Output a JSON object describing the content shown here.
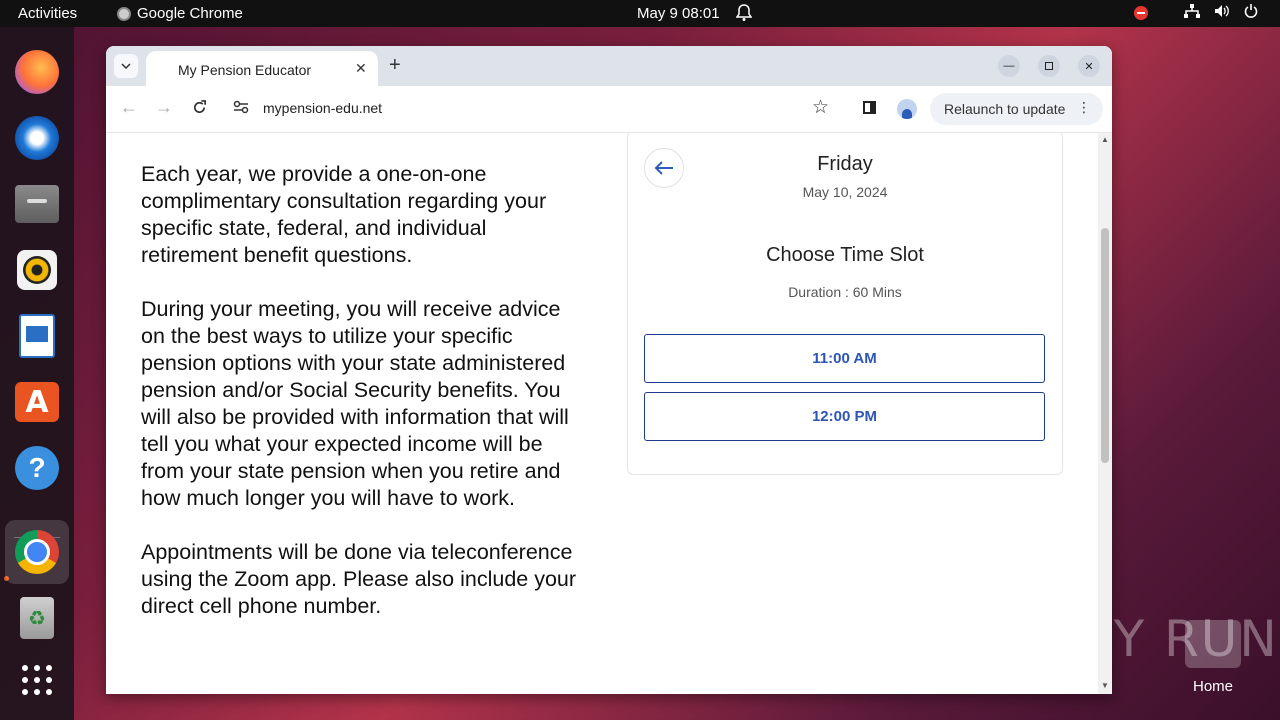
{
  "topbar": {
    "activities": "Activities",
    "app_name": "Google Chrome",
    "clock": "May 9  08:01"
  },
  "dock": {
    "items": [
      "firefox-icon",
      "thunderbird-icon",
      "files-icon",
      "rhythmbox-icon",
      "libreoffice-writer-icon",
      "app-center-icon",
      "help-icon",
      "chrome-icon",
      "trash-icon",
      "show-apps-icon"
    ]
  },
  "browser": {
    "tab_title": "My Pension Educator",
    "url": "mypension-edu.net",
    "relaunch_label": "Relaunch to update"
  },
  "article": {
    "paragraphs": [
      "Each year, we provide a one-on-one complimentary consultation regarding your specific state, federal, and individual retirement benefit questions.",
      "During your meeting, you will receive advice on the best ways to utilize your specific pension options with your state administered pension and/or Social Security benefits. You will also be provided with information that will tell you what your expected income will be from your state pension when you retire and how much longer you will have to work.",
      "Appointments will be done via teleconference using the Zoom app. Please also include your direct cell phone number."
    ]
  },
  "scheduler": {
    "day": "Friday",
    "date": "May 10, 2024",
    "heading": "Choose Time Slot",
    "duration": "Duration : 60 Mins",
    "slots": [
      "11:00 AM",
      "12:00 PM"
    ]
  },
  "desktop": {
    "home_label": "Home",
    "watermark": "ANY RUN"
  },
  "colors": {
    "accent": "#2c55b5",
    "slot_border": "#1e3a8a"
  }
}
